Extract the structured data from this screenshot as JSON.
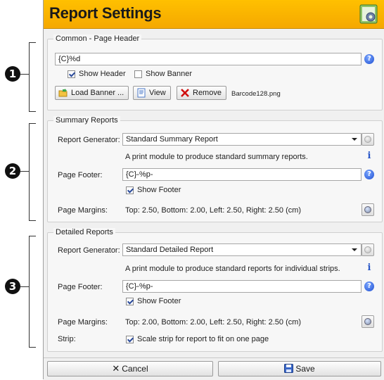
{
  "window": {
    "title": "Report Settings"
  },
  "annotations": [
    "1",
    "2",
    "3"
  ],
  "common": {
    "legend": "Common - Page Header",
    "header_value": "{C}%d",
    "show_header_label": "Show Header",
    "show_header_checked": true,
    "show_banner_label": "Show Banner",
    "show_banner_checked": false,
    "load_banner_label": "Load Banner ...",
    "view_label": "View",
    "remove_label": "Remove",
    "banner_file": "Barcode128.png"
  },
  "summary": {
    "legend": "Summary Reports",
    "generator_label": "Report Generator:",
    "generator_value": "Standard Summary Report",
    "description": "A print module to produce standard summary reports.",
    "footer_label": "Page Footer:",
    "footer_value": "{C}-%p-",
    "show_footer_label": "Show Footer",
    "show_footer_checked": true,
    "margins_label": "Page Margins:",
    "margins_value": "Top: 2.50, Bottom: 2.00, Left: 2.50, Right: 2.50 (cm)"
  },
  "detailed": {
    "legend": "Detailed Reports",
    "generator_label": "Report Generator:",
    "generator_value": "Standard Detailed Report",
    "description": "A print module to produce standard reports for individual strips.",
    "footer_label": "Page Footer:",
    "footer_value": "{C}-%p-",
    "show_footer_label": "Show Footer",
    "show_footer_checked": true,
    "margins_label": "Page Margins:",
    "margins_value": "Top: 2.00, Bottom: 2.00, Left: 2.50, Right: 2.50 (cm)",
    "strip_label": "Strip:",
    "strip_option_label": "Scale strip for report to fit on one page",
    "strip_option_checked": true
  },
  "footer": {
    "cancel_label": "Cancel",
    "save_label": "Save"
  },
  "colors": {
    "titlebar": "#ffc000",
    "help": "#1f4fd1",
    "remove_x": "#d01010"
  }
}
